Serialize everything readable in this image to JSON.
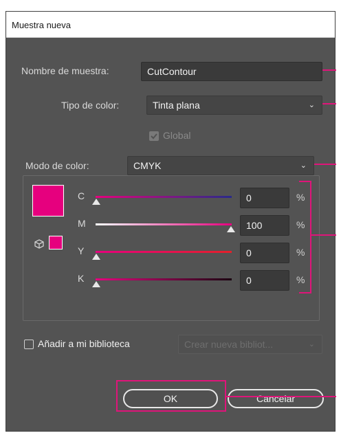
{
  "dialog": {
    "title": "Muestra nueva"
  },
  "swatch_name": {
    "label": "Nombre de muestra:",
    "value": "CutContour"
  },
  "color_type": {
    "label": "Tipo de color:",
    "value": "Tinta plana"
  },
  "global": {
    "label": "Global",
    "checked": true,
    "disabled": true
  },
  "color_mode": {
    "label": "Modo de color:",
    "value": "CMYK"
  },
  "channels": [
    {
      "name": "C",
      "value": "0",
      "unit": "%",
      "level": 0
    },
    {
      "name": "M",
      "value": "100",
      "unit": "%",
      "level": 100
    },
    {
      "name": "Y",
      "value": "0",
      "unit": "%",
      "level": 0
    },
    {
      "name": "K",
      "value": "0",
      "unit": "%",
      "level": 0
    }
  ],
  "library": {
    "label": "Añadir a mi biblioteca",
    "checked": false,
    "dropdown_value": "Crear nueva bibliot..."
  },
  "buttons": {
    "ok": "OK",
    "cancel": "Cancelar"
  },
  "colors": {
    "swatch": "#e6007e",
    "annotation": "#e0147a",
    "dialog_bg": "#535353"
  }
}
